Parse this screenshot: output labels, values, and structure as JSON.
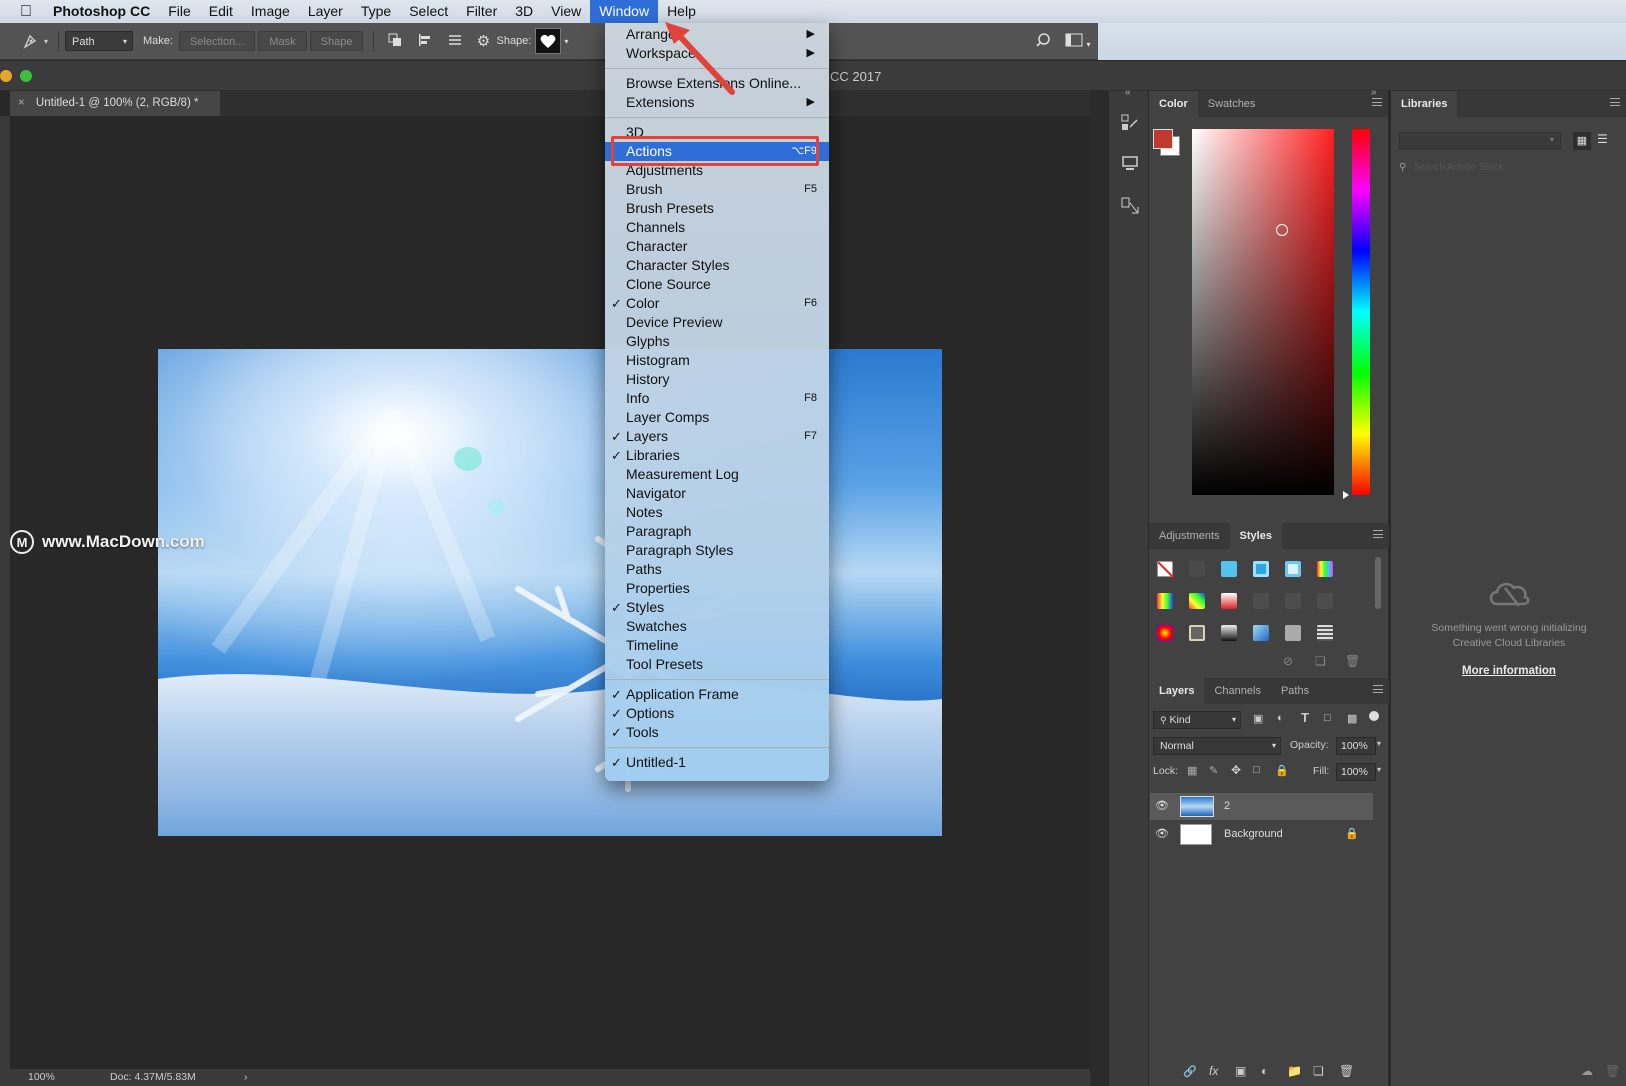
{
  "menubar": {
    "app_name": "Photoshop CC",
    "items": [
      "File",
      "Edit",
      "Image",
      "Layer",
      "Type",
      "Select",
      "Filter",
      "3D",
      "View",
      "Window",
      "Help"
    ],
    "active": "Window"
  },
  "options_bar": {
    "tool_mode": "Path",
    "make_label": "Make:",
    "selection_btn": "Selection...",
    "mask_btn": "Mask",
    "shape_btn": "Shape",
    "shape_label": "Shape:"
  },
  "title_bar": {
    "app_title_fragment": "CC 2017"
  },
  "document_tab": {
    "close": "×",
    "title": "Untitled-1 @ 100% (2, RGB/8) *"
  },
  "canvas": {
    "watermark": "www.MacDown.com"
  },
  "statusbar": {
    "zoom": "100%",
    "doc_size": "Doc: 4.37M/5.83M",
    "arrow": "›"
  },
  "window_menu": {
    "items": [
      {
        "label": "Arrange",
        "submenu": true
      },
      {
        "label": "Workspace",
        "submenu": true
      },
      {
        "separator": true
      },
      {
        "label": "Browse Extensions Online..."
      },
      {
        "label": "Extensions",
        "submenu": true
      },
      {
        "separator": true
      },
      {
        "label": "3D"
      },
      {
        "label": "Actions",
        "shortcut": "⌥F9",
        "highlighted": true
      },
      {
        "label": "Adjustments"
      },
      {
        "label": "Brush",
        "shortcut": "F5"
      },
      {
        "label": "Brush Presets"
      },
      {
        "label": "Channels"
      },
      {
        "label": "Character"
      },
      {
        "label": "Character Styles"
      },
      {
        "label": "Clone Source"
      },
      {
        "label": "Color",
        "shortcut": "F6",
        "checked": true
      },
      {
        "label": "Device Preview"
      },
      {
        "label": "Glyphs"
      },
      {
        "label": "Histogram"
      },
      {
        "label": "History"
      },
      {
        "label": "Info",
        "shortcut": "F8"
      },
      {
        "label": "Layer Comps"
      },
      {
        "label": "Layers",
        "shortcut": "F7",
        "checked": true
      },
      {
        "label": "Libraries",
        "checked": true
      },
      {
        "label": "Measurement Log"
      },
      {
        "label": "Navigator"
      },
      {
        "label": "Notes"
      },
      {
        "label": "Paragraph"
      },
      {
        "label": "Paragraph Styles"
      },
      {
        "label": "Paths"
      },
      {
        "label": "Properties"
      },
      {
        "label": "Styles",
        "checked": true
      },
      {
        "label": "Swatches"
      },
      {
        "label": "Timeline"
      },
      {
        "label": "Tool Presets"
      },
      {
        "separator": true
      },
      {
        "label": "Application Frame",
        "checked": true
      },
      {
        "label": "Options",
        "checked": true
      },
      {
        "label": "Tools",
        "checked": true
      },
      {
        "separator": true
      },
      {
        "label": "Untitled-1",
        "checked": true
      }
    ]
  },
  "color_panel": {
    "tabs": [
      "Color",
      "Swatches"
    ],
    "active": "Color",
    "foreground": "#c0392f",
    "background": "#ffffff"
  },
  "adjust_panel": {
    "tabs": [
      "Adjustments",
      "Styles"
    ],
    "active": "Styles"
  },
  "layers_panel": {
    "tabs": [
      "Layers",
      "Channels",
      "Paths"
    ],
    "active": "Layers",
    "filter_kind": "Kind",
    "blend_mode": "Normal",
    "opacity_label": "Opacity:",
    "opacity": "100%",
    "lock_label": "Lock:",
    "fill_label": "Fill:",
    "fill": "100%",
    "layers": [
      {
        "name": "2",
        "visible": true,
        "selected": true
      },
      {
        "name": "Background",
        "visible": true,
        "locked": true
      }
    ]
  },
  "libraries_panel": {
    "title": "Libraries",
    "search_placeholder": "Search Adobe Stock",
    "error_line1": "Something went wrong initializing",
    "error_line2": "Creative Cloud Libraries",
    "more_info": "More information"
  },
  "colors": {
    "menu_highlight": "#2f6ed9",
    "callout_red": "#e0433a"
  }
}
